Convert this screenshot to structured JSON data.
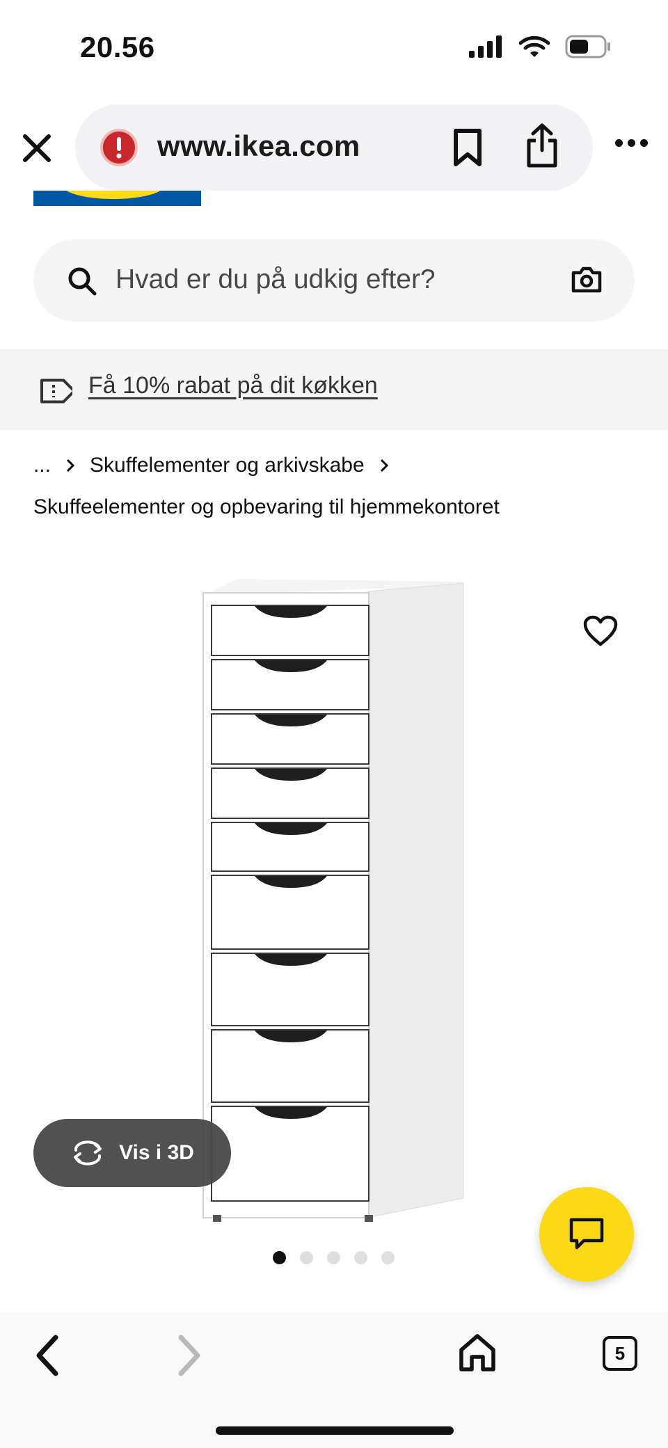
{
  "status_bar": {
    "time": "20.56"
  },
  "browser": {
    "url": "www.ikea.com",
    "icons": [
      "close-icon",
      "warning-icon",
      "bookmark-icon",
      "share-icon",
      "more-icon"
    ]
  },
  "search": {
    "placeholder": "Hvad er du på udkig efter?"
  },
  "promo": {
    "text": "Få 10% rabat på dit køkken"
  },
  "breadcrumb": {
    "ellipsis": "...",
    "category": "Skuffelementer og arkivskabe",
    "current": "Skuffeelementer og opbevaring til hjemmekontoret"
  },
  "product": {
    "view_3d_label": "Vis i 3D",
    "carousel": {
      "count": 5,
      "active_index": 0
    }
  },
  "bottom_nav": {
    "tab_count": "5"
  },
  "colors": {
    "brand_blue": "#0058a3",
    "brand_yellow": "#fbd914",
    "warning_red": "#c8282b"
  }
}
